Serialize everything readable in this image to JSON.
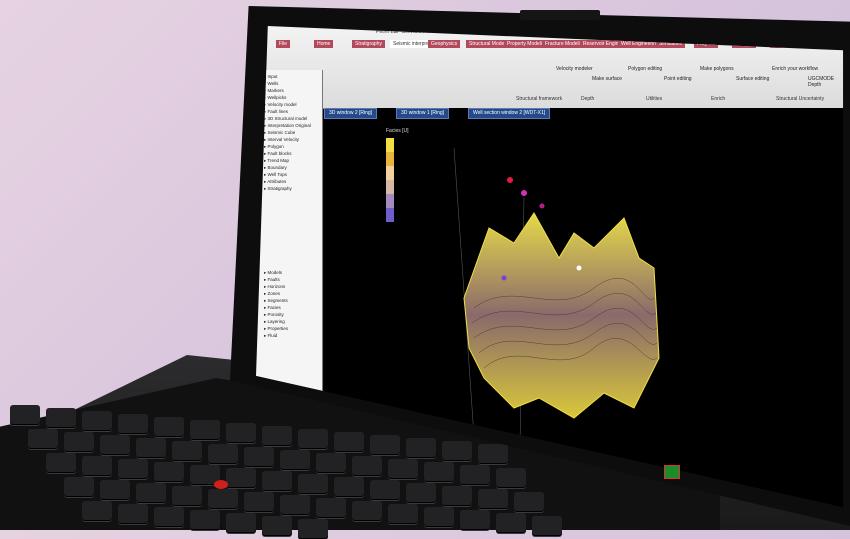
{
  "app": {
    "title": "Petrel E&P Software Platform",
    "ribbon_tabs": [
      "File",
      "Home",
      "Stratigraphy",
      "Seismic interpretation",
      "Geophysics",
      "Structural Modeling",
      "Property Modeling",
      "Fracture Modeling",
      "Reservoir Engineering",
      "Well Engineering",
      "Simulation",
      "Plug-ins",
      "Window",
      "3D"
    ],
    "ribbon_buttons": [
      "Velocity modeler",
      "Make surface",
      "Polygon editing",
      "Point editing",
      "Make polygons",
      "Surface editing",
      "Enrich your workflow",
      "UGCMODE Depth"
    ],
    "ribbon_groups": [
      "Structural framework",
      "Depth",
      "Utilities",
      "Enrich",
      "Structural Uncertainty"
    ],
    "view_tabs": [
      "3D window 2 [Ring]",
      "3D window 1 [Ring]",
      "Well section window 2 [WDT-X1]"
    ],
    "tree_input": [
      "Input",
      "Wells",
      "Markers",
      "Wellpicks",
      "Velocity model",
      "Fault lines",
      "3D Structural model",
      "Interpretation Original",
      "Seismic Cube",
      "Interval Velocity",
      "Polygon",
      "Fault blocks",
      "Trend Map",
      "Boundary",
      "Well Tops",
      "Attributes",
      "Stratigraphy"
    ],
    "tree_models": [
      "Models",
      "Faults",
      "Horizons",
      "Zones",
      "Segments",
      "Facies",
      "Porosity",
      "Layering",
      "Properties",
      "Fluid"
    ],
    "legend_title": "Facies [U]",
    "legend_colors": [
      "#f0e043",
      "#e9b33d",
      "#f4d19a",
      "#d5b8a3",
      "#a58abf",
      "#6e5ec9"
    ],
    "accent": "#b24a5b"
  }
}
